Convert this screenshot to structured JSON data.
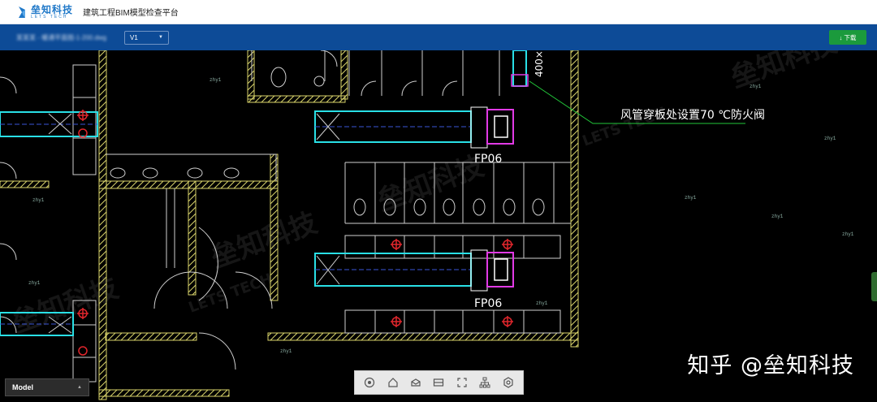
{
  "header": {
    "logo_cn": "垒知科技",
    "logo_en": "LETS TECH",
    "app_title": "建筑工程BIM模型检查平台"
  },
  "toolbar": {
    "file_name": "某某某 - 暖通平面图-1-200.dwg",
    "version": "V1",
    "download_label": "↓ 下载"
  },
  "drawing": {
    "annotation": "风管穿板处设置70 ℃防火阀",
    "fp_label": "FP06",
    "fp_label_2": "FP06",
    "duct_size": "400×…",
    "small_tag": "zhy1",
    "bg_watermark_cn": "垒知科技",
    "bg_watermark_en": "LETS TECH"
  },
  "bottom": {
    "model_tab": "Model",
    "tools": [
      "orbit-icon",
      "home-icon",
      "box-icon",
      "section-icon",
      "fullscreen-icon",
      "tree-icon",
      "settings-icon"
    ]
  },
  "watermark": "知乎 @垒知科技",
  "colors": {
    "header_bg": "#ffffff",
    "toolbar_bg": "#0d4b97",
    "download_bg": "#1b9a3c",
    "wall_yellow": "#d7d26a",
    "duct_cyan": "#29e0e6",
    "magenta": "#e23ae6",
    "red": "#e0262c",
    "leader_green": "#22c83a"
  }
}
